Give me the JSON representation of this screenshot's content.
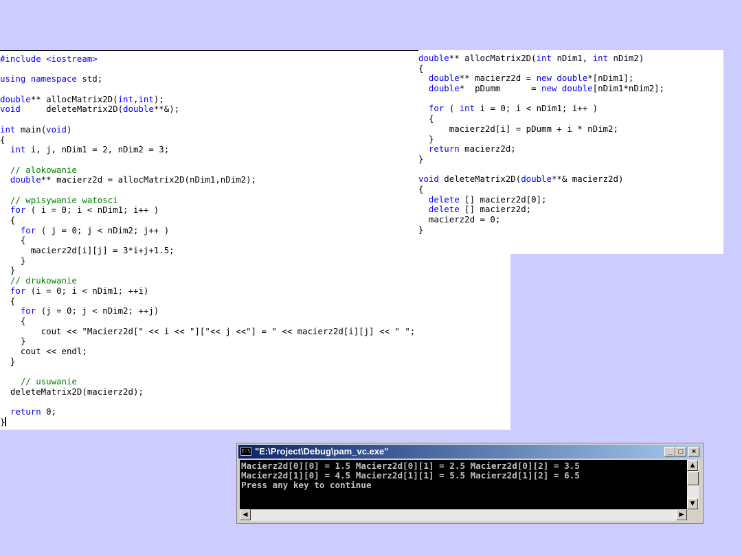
{
  "main_code": {
    "lines": [
      [
        {
          "t": "#include <iostream>",
          "c": "kw"
        }
      ],
      [],
      [
        {
          "t": "using namespace",
          "c": "kw"
        },
        {
          "t": " std;"
        }
      ],
      [],
      [
        {
          "t": "double",
          "c": "kw"
        },
        {
          "t": "** allocMatrix2D("
        },
        {
          "t": "int",
          "c": "kw"
        },
        {
          "t": ","
        },
        {
          "t": "int",
          "c": "kw"
        },
        {
          "t": ");"
        }
      ],
      [
        {
          "t": "void",
          "c": "kw"
        },
        {
          "t": "     deleteMatrix2D("
        },
        {
          "t": "double",
          "c": "kw"
        },
        {
          "t": "**&);"
        }
      ],
      [],
      [
        {
          "t": "int",
          "c": "kw"
        },
        {
          "t": " main("
        },
        {
          "t": "void",
          "c": "kw"
        },
        {
          "t": ")"
        }
      ],
      [
        {
          "t": "{"
        }
      ],
      [
        {
          "t": "  "
        },
        {
          "t": "int",
          "c": "kw"
        },
        {
          "t": " i, j, nDim1 = 2, nDim2 = 3;"
        }
      ],
      [],
      [
        {
          "t": "  // alokowanie",
          "c": "cm"
        }
      ],
      [
        {
          "t": "  "
        },
        {
          "t": "double",
          "c": "kw"
        },
        {
          "t": "** macierz2d = allocMatrix2D(nDim1,nDim2);"
        }
      ],
      [],
      [
        {
          "t": "  // wpisywanie watosci",
          "c": "cm"
        }
      ],
      [
        {
          "t": "  "
        },
        {
          "t": "for",
          "c": "kw"
        },
        {
          "t": " ( i = 0; i < nDim1; i++ )"
        }
      ],
      [
        {
          "t": "  {"
        }
      ],
      [
        {
          "t": "    "
        },
        {
          "t": "for",
          "c": "kw"
        },
        {
          "t": " ( j = 0; j < nDim2; j++ )"
        }
      ],
      [
        {
          "t": "    {"
        }
      ],
      [
        {
          "t": "      macierz2d[i][j] = 3*i+j+1.5;"
        }
      ],
      [
        {
          "t": "    }"
        }
      ],
      [
        {
          "t": "  }"
        }
      ],
      [
        {
          "t": "  // drukowanie",
          "c": "cm"
        }
      ],
      [
        {
          "t": "  "
        },
        {
          "t": "for",
          "c": "kw"
        },
        {
          "t": " (i = 0; i < nDim1; ++i)"
        }
      ],
      [
        {
          "t": "  {"
        }
      ],
      [
        {
          "t": "    "
        },
        {
          "t": "for",
          "c": "kw"
        },
        {
          "t": " (j = 0; j < nDim2; ++j)"
        }
      ],
      [
        {
          "t": "    {"
        }
      ],
      [
        {
          "t": "        cout << \"Macierz2d[\" << i << \"][\"<< j <<\"] = \" << macierz2d[i][j] << \" \";"
        }
      ],
      [
        {
          "t": "    }"
        }
      ],
      [
        {
          "t": "    cout << endl;"
        }
      ],
      [
        {
          "t": "  }"
        }
      ],
      [],
      [
        {
          "t": "    // usuwanie",
          "c": "cm"
        }
      ],
      [
        {
          "t": "  deleteMatrix2D(macierz2d);"
        }
      ],
      [],
      [
        {
          "t": "  "
        },
        {
          "t": "return",
          "c": "kw"
        },
        {
          "t": " 0;"
        }
      ],
      [
        {
          "t": "}",
          "caret": true
        }
      ]
    ]
  },
  "right_code": {
    "lines": [
      [
        {
          "t": "double",
          "c": "kw"
        },
        {
          "t": "** allocMatrix2D("
        },
        {
          "t": "int",
          "c": "kw"
        },
        {
          "t": " nDim1, "
        },
        {
          "t": "int",
          "c": "kw"
        },
        {
          "t": " nDim2)"
        }
      ],
      [
        {
          "t": "{"
        }
      ],
      [
        {
          "t": "  "
        },
        {
          "t": "double",
          "c": "kw"
        },
        {
          "t": "** macierz2d = "
        },
        {
          "t": "new double",
          "c": "kw"
        },
        {
          "t": "*[nDim1];"
        }
      ],
      [
        {
          "t": "  "
        },
        {
          "t": "double",
          "c": "kw"
        },
        {
          "t": "*  pDumm      = "
        },
        {
          "t": "new double",
          "c": "kw"
        },
        {
          "t": "[nDim1*nDim2];"
        }
      ],
      [],
      [
        {
          "t": "  "
        },
        {
          "t": "for",
          "c": "kw"
        },
        {
          "t": " ( "
        },
        {
          "t": "int",
          "c": "kw"
        },
        {
          "t": " i = 0; i < nDim1; i++ )"
        }
      ],
      [
        {
          "t": "  {"
        }
      ],
      [
        {
          "t": "      macierz2d[i] = pDumm + i * nDim2;"
        }
      ],
      [
        {
          "t": "  }"
        }
      ],
      [
        {
          "t": "  "
        },
        {
          "t": "return",
          "c": "kw"
        },
        {
          "t": " macierz2d;"
        }
      ],
      [
        {
          "t": "}"
        }
      ],
      [],
      [
        {
          "t": "void",
          "c": "kw"
        },
        {
          "t": " deleteMatrix2D("
        },
        {
          "t": "double",
          "c": "kw"
        },
        {
          "t": "**& macierz2d)"
        }
      ],
      [
        {
          "t": "{"
        }
      ],
      [
        {
          "t": "  "
        },
        {
          "t": "delete",
          "c": "kw"
        },
        {
          "t": " [] macierz2d[0];"
        }
      ],
      [
        {
          "t": "  "
        },
        {
          "t": "delete",
          "c": "kw"
        },
        {
          "t": " [] macierz2d;"
        }
      ],
      [
        {
          "t": "  macierz2d = 0;"
        }
      ],
      [
        {
          "t": "}"
        }
      ]
    ]
  },
  "console": {
    "title": "\"E:\\Project\\Debug\\pam_vc.exe\"",
    "icon": "console-app-icon",
    "icon_text": "C:\\",
    "buttons": {
      "minimize": "_",
      "maximize": "□",
      "close": "×"
    },
    "output": [
      "Macierz2d[0][0] = 1.5 Macierz2d[0][1] = 2.5 Macierz2d[0][2] = 3.5",
      "Macierz2d[1][0] = 4.5 Macierz2d[1][1] = 5.5 Macierz2d[1][2] = 6.5",
      "Press any key to continue"
    ],
    "scroll": {
      "up": "▲",
      "down": "▼",
      "left": "◀",
      "right": "▶"
    }
  },
  "colors": {
    "background": "#ccccff",
    "keyword": "#0000ff",
    "comment": "#008000"
  }
}
